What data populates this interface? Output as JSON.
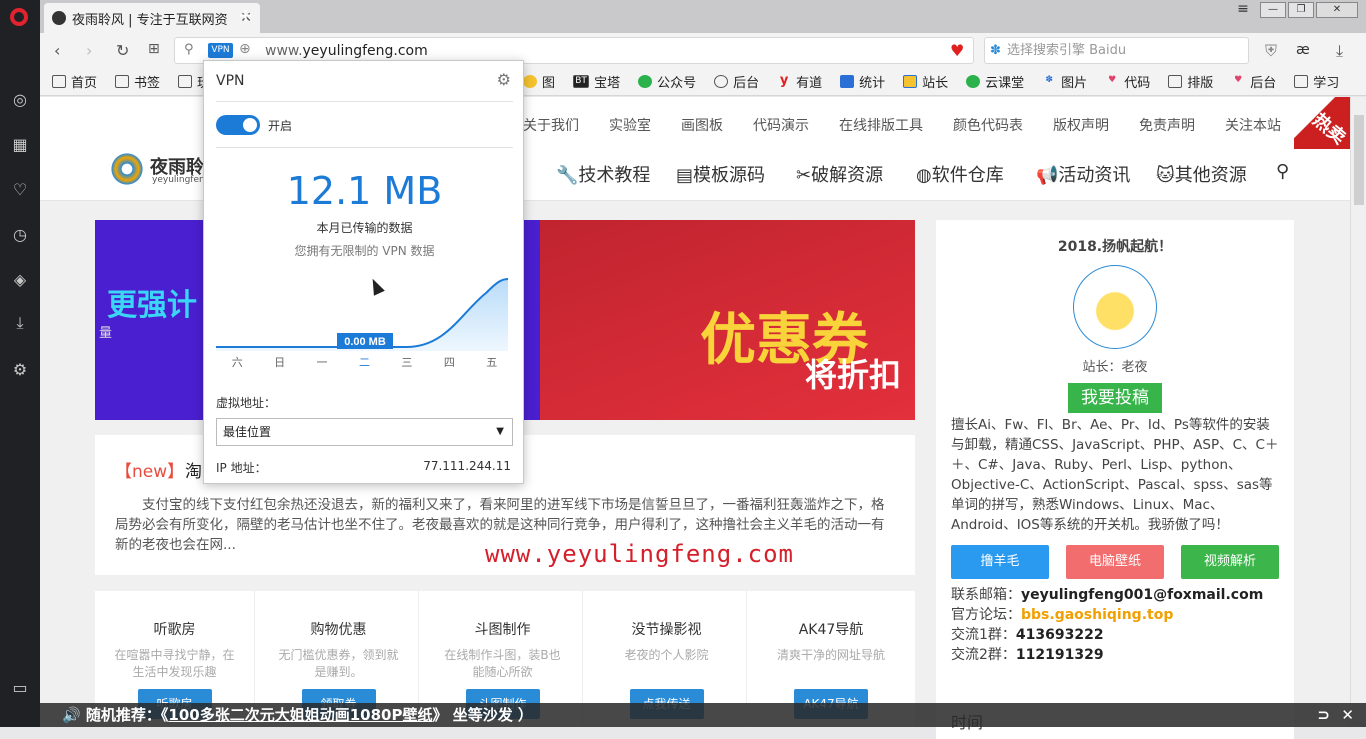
{
  "browser": {
    "tab_title": "夜雨聆风 | 专注于互联网资",
    "url_prefix": "www.",
    "url_domain": "yeyulingfeng.com",
    "vpn_badge": "VPN",
    "search_placeholder": "选择搜索引擎 Baidu",
    "bookmarks": [
      "首页",
      "书签",
      "玩",
      "图",
      "宝塔",
      "公众号",
      "后台",
      "有道",
      "统计",
      "站长",
      "云课堂",
      "图片",
      "代码",
      "排版",
      "后台",
      "学习"
    ]
  },
  "site": {
    "logo_text": "夜雨聆",
    "logo_sub": "yeyulingfeng.",
    "top_links": [
      "关于我们",
      "实验室",
      "画图板",
      "代码演示",
      "在线排版工具",
      "颜色代码表",
      "版权声明",
      "免责声明",
      "关注本站"
    ],
    "hot_label": "热卖",
    "main_nav": [
      "技术教程",
      "模板源码",
      "破解资源",
      "软件仓库",
      "活动资讯",
      "其他资源"
    ],
    "banner_left_text": "更强计",
    "banner_left_sub": "量",
    "banner_right_text": "优惠券",
    "banner_right_sub": "将折扣",
    "article_badge": "【new】",
    "article_title": "淘",
    "article_body": "支付宝的线下支付红包余热还没退去，新的福利又来了，看来阿里的进军线下市场是信誓旦旦了，一番福利狂轰滥炸之下，格局势必会有所变化，隔壁的老马估计也坐不住了。老夜最喜欢的就是这种同行竞争，用户得利了，这种撸社会主义羊毛的活动一有新的老夜也会在网...",
    "watermark": "www.yeyulingfeng.com",
    "cards": [
      {
        "title": "听歌房",
        "desc": "在喧嚣中寻找宁静，在生活中发现乐趣",
        "button": "听歌房"
      },
      {
        "title": "购物优惠",
        "desc": "无门槛优惠券，领到就是赚到。",
        "button": "领取券"
      },
      {
        "title": "斗图制作",
        "desc": "在线制作斗图，装B也能随心所欲",
        "button": "斗图制作"
      },
      {
        "title": "没节操影视",
        "desc": "老夜的个人影院",
        "button": "点我传送"
      },
      {
        "title": "AK47导航",
        "desc": "清爽干净的网址导航",
        "button": "AK47导航"
      }
    ],
    "sidebar_title": "2018.扬帆起航！",
    "sidebar_role": "站长：老夜",
    "sidebar_submit": "我要投稿",
    "sidebar_desc": "擅长Ai、Fw、Fl、Br、Ae、Pr、Id、Ps等软件的安装与卸载，精通CSS、JavaScript、PHP、ASP、C、C＋＋、C#、Java、Ruby、Perl、Lisp、python、Objective-C、ActionScript、Pascal、spss、sas等单词的拼写，熟悉Windows、Linux、Mac、Android、IOS等系统的开关机。我骄傲了吗！",
    "sidebar_buttons": [
      "撸羊毛",
      "电脑壁纸",
      "视频解析"
    ],
    "email_label": "联系邮箱：",
    "email": "yeyulingfeng001@foxmail.com",
    "forum_label": "官方论坛：",
    "forum": "bbs.gaoshiqing.top",
    "group1_label": "交流1群：",
    "group1": "413693222",
    "group2_label": "交流2群：",
    "group2": "112191329",
    "time_label": "时间",
    "ticker_prefix": "随机推荐：《",
    "ticker_link": "100多张二次元大姐姐动画1080P壁纸",
    "ticker_suffix": "》 坐等沙发 ）"
  },
  "vpn": {
    "title": "VPN",
    "toggle_label": "开启",
    "enabled": true,
    "amount": "12.1 MB",
    "amount_label": "本月已传输的数据",
    "unlimited": "您拥有无限制的 VPN 数据",
    "tooltip": "0.00 MB",
    "days": [
      "六",
      "日",
      "一",
      "二",
      "三",
      "四",
      "五"
    ],
    "active_day": "二",
    "location_label": "虚拟地址：",
    "location_value": "最佳位置",
    "ip_label": "IP 地址：",
    "ip_value": "77.111.244.11"
  },
  "colors": {
    "accent": "#1d7bd8",
    "opera_red": "#e0232e",
    "green": "#37b44a"
  }
}
